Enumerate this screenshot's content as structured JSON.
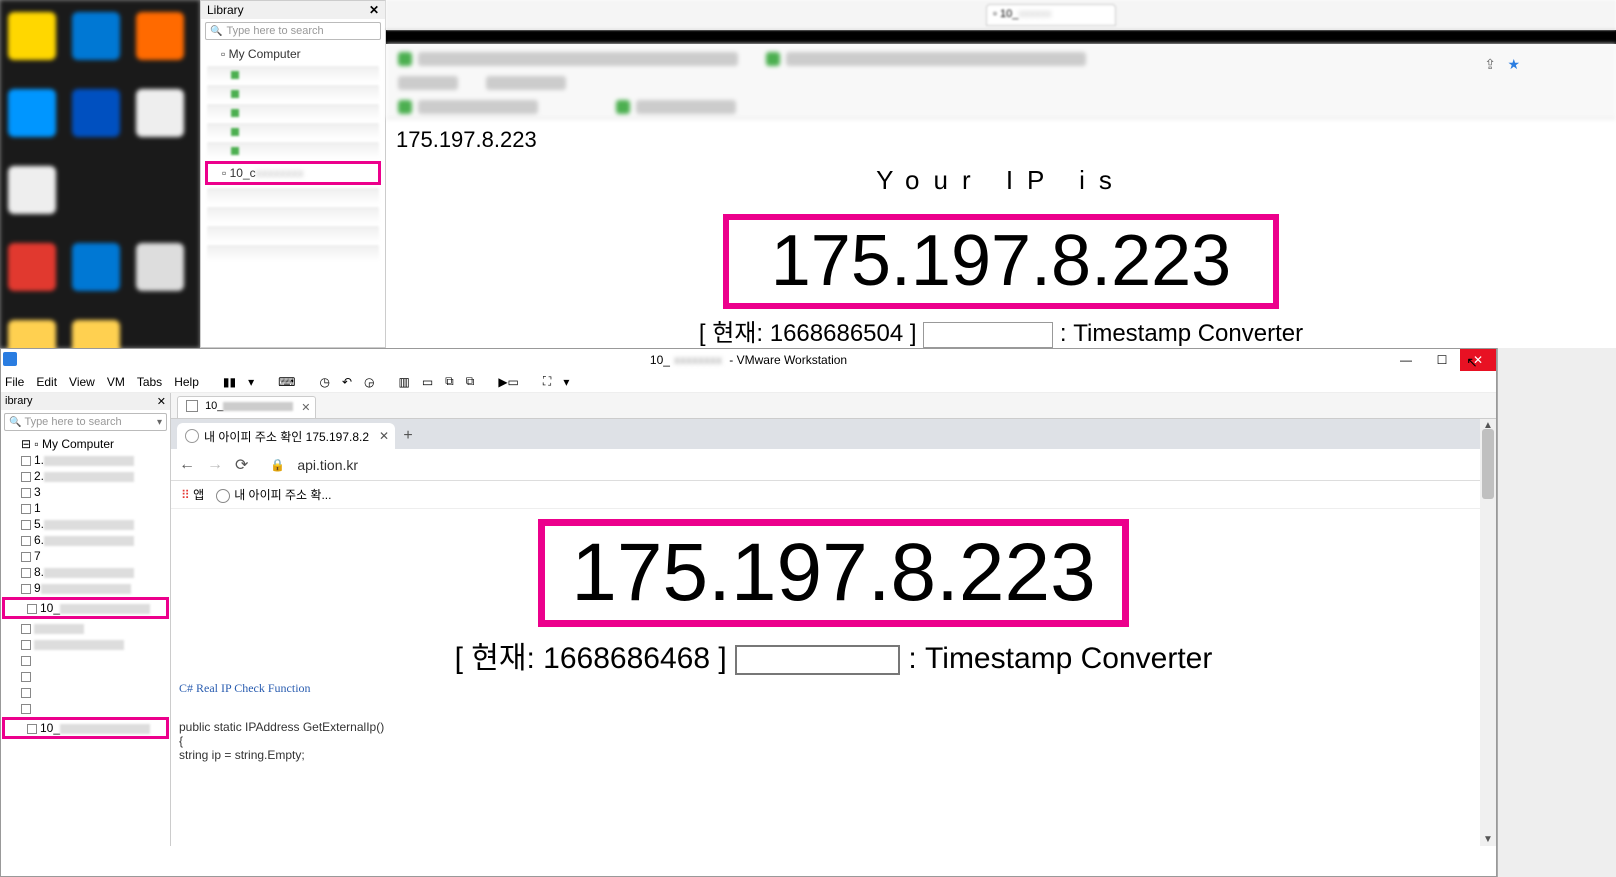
{
  "top": {
    "library": {
      "title": "Library",
      "search_placeholder": "Type here to search",
      "root": "My Computer",
      "highlighted_item": "10_c"
    },
    "vm_tab": "10_",
    "page": {
      "ip_small": "175.197.8.223",
      "your_ip_label": "Your IP is",
      "ip_big": "175.197.8.223",
      "ts_prefix": "[ 현재: ",
      "ts_value": "1668686504",
      "ts_suffix": " ]",
      "ts_converter_label": " : Timestamp Converter"
    }
  },
  "vmware": {
    "title_prefix": "10_",
    "title_suffix": " - VMware Workstation",
    "menu": {
      "file": "File",
      "edit": "Edit",
      "view": "View",
      "vm": "VM",
      "tabs": "Tabs",
      "help": "Help"
    },
    "library": {
      "title": "ibrary",
      "search_placeholder": "Type here to search",
      "root": "My Computer",
      "items": [
        "1.",
        "2.",
        "3",
        "1",
        "5.",
        "6.",
        "7",
        "8.",
        "9",
        "10_",
        "",
        "",
        "",
        "",
        "",
        "",
        "10_"
      ],
      "highlight_indices": [
        9,
        16
      ]
    },
    "vm_tab": "10_",
    "chrome": {
      "tab_title": "내 아이피 주소 확인 175.197.8.2",
      "url": "api.tion.kr",
      "bookmark_apps": "앱",
      "bookmark_ip": "내 아이피 주소 확..."
    },
    "page": {
      "ip_big": "175.197.8.223",
      "ts_prefix": "[ 현재: ",
      "ts_value": "1668686468",
      "ts_suffix": " ]",
      "ts_converter_label": " : Timestamp Converter",
      "code_title": "C# Real IP Check Function",
      "code_line1": "public static IPAddress GetExternalIp()",
      "code_line2": "{",
      "code_line3": "        string ip = string.Empty;"
    }
  }
}
